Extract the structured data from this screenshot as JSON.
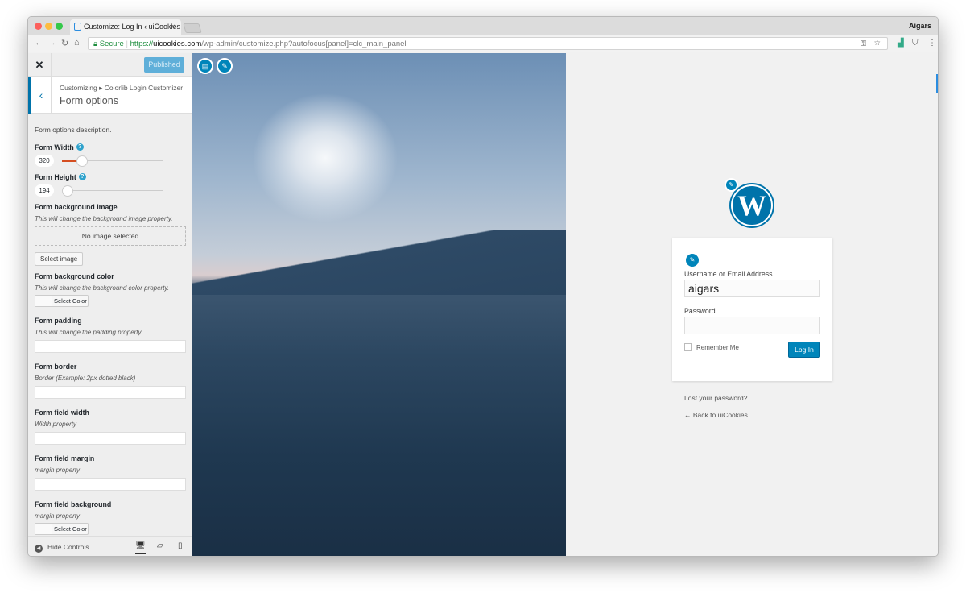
{
  "browser": {
    "tab_title": "Customize: Log In ‹ uiCookies",
    "user": "Aigars",
    "secure_label": "Secure",
    "url_scheme": "https://",
    "url_host": "uicookies.com",
    "url_path": "/wp-admin/customize.php?autofocus[panel]=clc_main_panel"
  },
  "sidebar": {
    "close": "✕",
    "publish_label": "Published",
    "breadcrumb": "Customizing ▸ Colorlib Login Customizer",
    "section_title": "Form options",
    "description": "Form options description.",
    "form_width": {
      "label": "Form Width",
      "value": "320",
      "fraction": 0.2
    },
    "form_height": {
      "label": "Form Height",
      "value": "194",
      "fraction": 0.0
    },
    "bg_image": {
      "label": "Form background image",
      "desc": "This will change the background image property.",
      "placeholder": "No image selected",
      "button": "Select image"
    },
    "bg_color": {
      "label": "Form background color",
      "desc": "This will change the background color property.",
      "button": "Select Color"
    },
    "padding": {
      "label": "Form padding",
      "desc": "This will change the padding property."
    },
    "border": {
      "label": "Form border",
      "desc": "Border (Example: 2px dotted black)"
    },
    "field_width": {
      "label": "Form field width",
      "desc": "Width property"
    },
    "field_margin": {
      "label": "Form field margin",
      "desc": "margin property"
    },
    "field_bg": {
      "label": "Form field background",
      "desc": "margin property",
      "button": "Select Color"
    },
    "hide_controls": "Hide Controls"
  },
  "login": {
    "username_label": "Username or Email Address",
    "username_value": "aigars",
    "password_label": "Password",
    "remember_label": "Remember Me",
    "login_button": "Log In",
    "lost_password": "Lost your password?",
    "back_link": "← Back to uiCookies"
  },
  "colors": {
    "accent": "#0085ba"
  }
}
